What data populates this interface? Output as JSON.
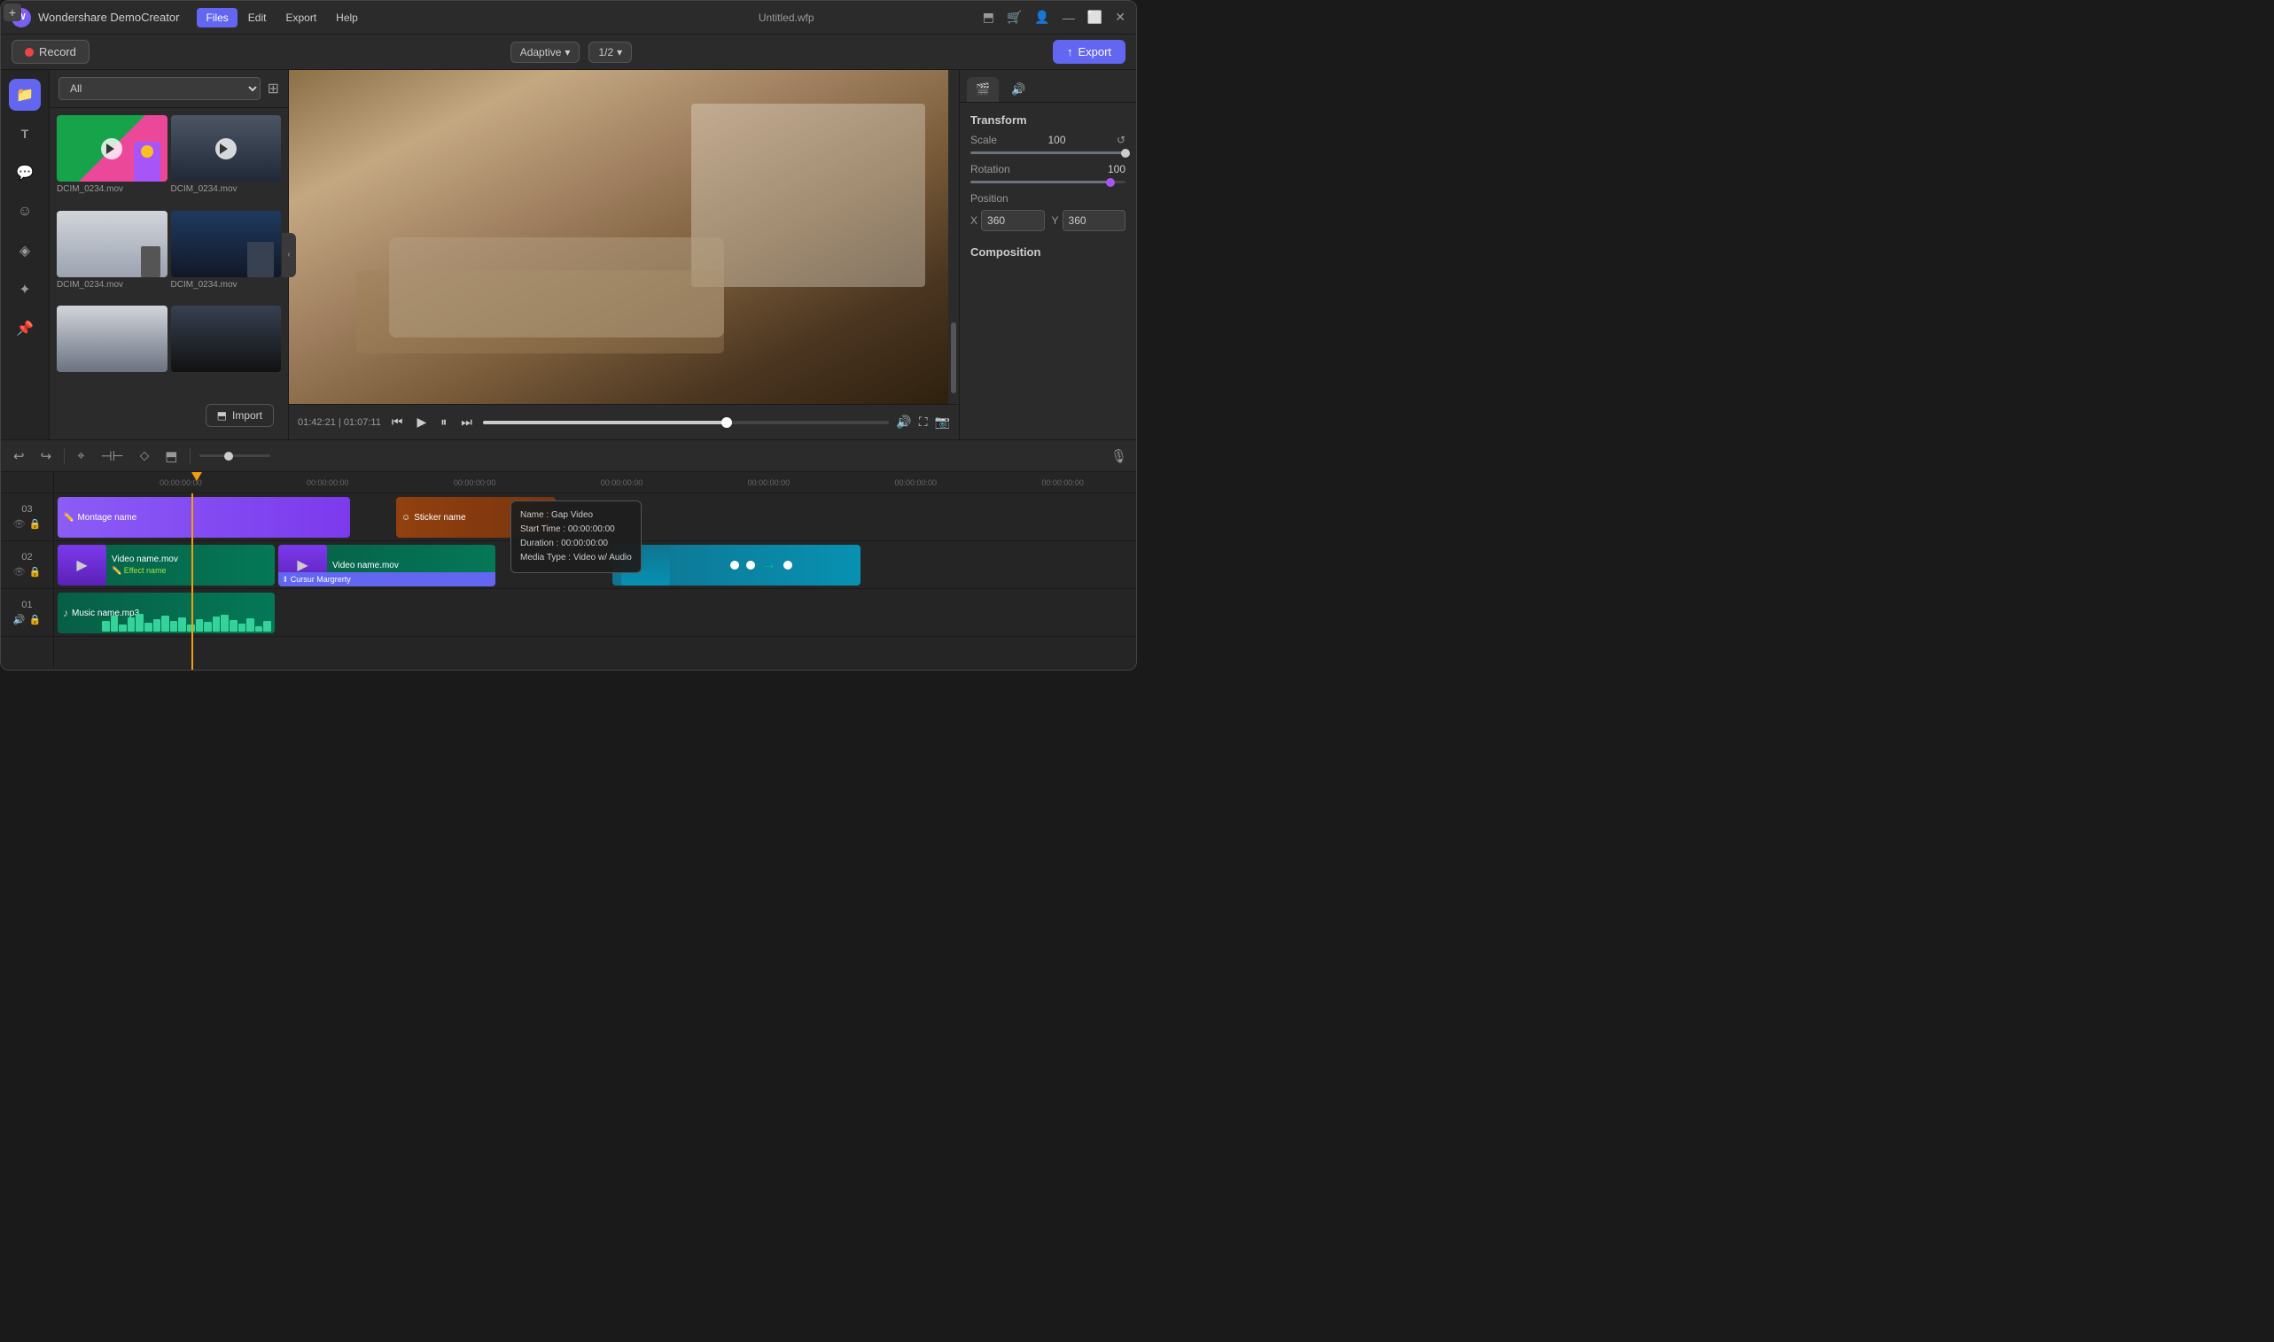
{
  "app": {
    "logo": "W",
    "name": "Wondershare DemoCreator",
    "window_title": "Untitled.wfp"
  },
  "menu": {
    "items": [
      "Files",
      "Edit",
      "Export",
      "Help"
    ],
    "active": "Files"
  },
  "toolbar": {
    "record_label": "Record",
    "adaptive_label": "Adaptive",
    "ratio_label": "1/2",
    "export_label": "Export"
  },
  "sidebar": {
    "icons": [
      {
        "name": "folder",
        "symbol": "📁",
        "active": true
      },
      {
        "name": "text",
        "symbol": "T",
        "active": false
      },
      {
        "name": "speech",
        "symbol": "💬",
        "active": false
      },
      {
        "name": "emoji",
        "symbol": "☺",
        "active": false
      },
      {
        "name": "filter",
        "symbol": "◈",
        "active": false
      },
      {
        "name": "effects",
        "symbol": "✦",
        "active": false
      },
      {
        "name": "pin",
        "symbol": "📌",
        "active": false
      }
    ]
  },
  "media_panel": {
    "filter": "All",
    "import_label": "Import",
    "items": [
      {
        "label": "DCIM_0234.mov",
        "thumb": "thumb-sim-1"
      },
      {
        "label": "DCIM_0234.mov",
        "thumb": "thumb-sim-2"
      },
      {
        "label": "DCIM_0234.mov",
        "thumb": "thumb-sim-3"
      },
      {
        "label": "DCIM_0234.mov",
        "thumb": "thumb-sim-4"
      },
      {
        "label": "",
        "thumb": "thumb-sim-5"
      },
      {
        "label": "",
        "thumb": "thumb-sim-6"
      }
    ]
  },
  "video_controls": {
    "time_current": "01:42:21",
    "time_total": "01:07:11",
    "progress_pct": 60
  },
  "properties": {
    "transform_title": "Transform",
    "scale_label": "Scale",
    "scale_value": "100",
    "rotation_label": "Rotation",
    "rotation_value": "100",
    "position_label": "Position",
    "x_label": "X",
    "x_value": "360",
    "y_label": "Y",
    "y_value": "360",
    "composition_title": "Composition"
  },
  "timeline": {
    "ruler_marks": [
      "00:00:00:00",
      "00:00:00:00",
      "00:00:00:00",
      "00:00:00:00",
      "00:00:00:00",
      "00:00:00:00",
      "00:00:00:00"
    ],
    "tracks": [
      {
        "num": "03",
        "clips": [
          {
            "label": "Montage name",
            "icon": "✏️"
          },
          {
            "label": "Sticker name",
            "icon": "☺"
          }
        ]
      },
      {
        "num": "02",
        "clips": [
          {
            "label": "Video name.mov",
            "sub": "Effect name",
            "icon": "▶"
          },
          {
            "label": "Video name.mov",
            "icon": "▶"
          },
          {
            "label": "Cursur Margrerty"
          }
        ]
      },
      {
        "num": "01",
        "clips": [
          {
            "label": "Music name.mp3",
            "icon": "♪"
          }
        ]
      }
    ],
    "gap_tooltip": {
      "name": "Name : Gap Video",
      "start": "Start Time : 00:00:00:00",
      "duration": "Duration : 00:00:00:00",
      "media_type": "Media Type : Video w/ Audio"
    }
  }
}
